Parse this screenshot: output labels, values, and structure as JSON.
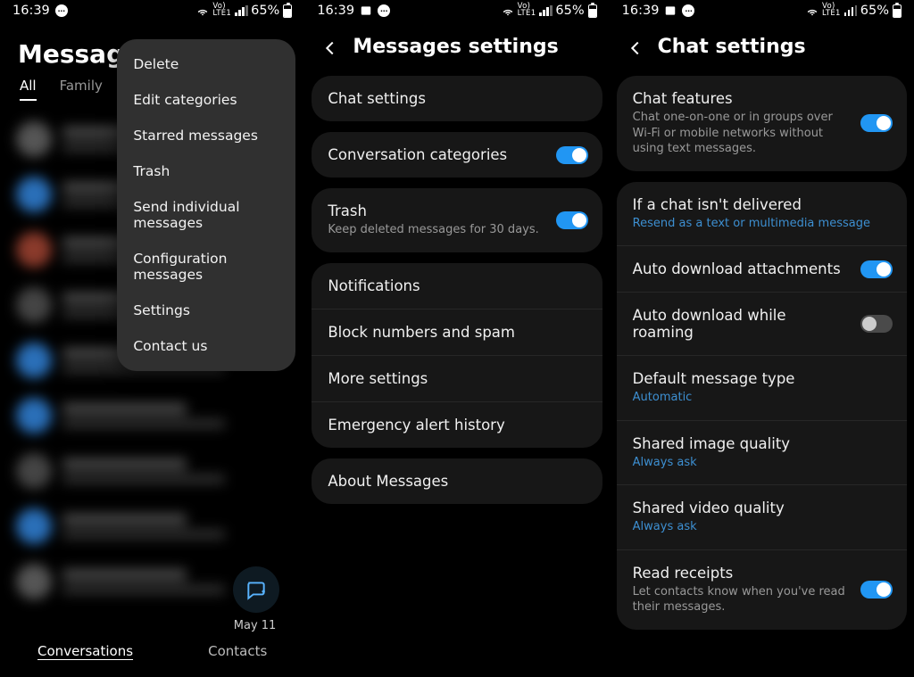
{
  "status": {
    "time": "16:39",
    "volte_top": "Vo)",
    "volte_bot": "LTE1",
    "battery": "65%"
  },
  "p1": {
    "title": "Messages",
    "tabs": [
      "All",
      "Family"
    ],
    "menu": [
      "Delete",
      "Edit categories",
      "Starred messages",
      "Trash",
      "Send individual messages",
      "Configuration messages",
      "Settings",
      "Contact us"
    ],
    "fab_date": "May 11",
    "bottom_nav": [
      "Conversations",
      "Contacts"
    ]
  },
  "p2": {
    "title": "Messages settings",
    "groups": [
      [
        {
          "title": "Chat settings"
        }
      ],
      [
        {
          "title": "Conversation categories",
          "toggle": true
        }
      ],
      [
        {
          "title": "Trash",
          "sub": "Keep deleted messages for 30 days.",
          "toggle": true
        }
      ],
      [
        {
          "title": "Notifications"
        },
        {
          "title": "Block numbers and spam"
        },
        {
          "title": "More settings"
        },
        {
          "title": "Emergency alert history"
        }
      ],
      [
        {
          "title": "About Messages"
        }
      ]
    ]
  },
  "p3": {
    "title": "Chat settings",
    "groups": [
      [
        {
          "title": "Chat features",
          "sub": "Chat one-on-one or in groups over Wi-Fi or mobile networks without using text messages.",
          "toggle": true
        }
      ],
      [
        {
          "title": "If a chat isn't delivered",
          "sub": "Resend as a text or multimedia message",
          "blue": true
        },
        {
          "title": "Auto download attachments",
          "toggle": true
        },
        {
          "title": "Auto download while roaming",
          "toggle": false
        },
        {
          "title": "Default message type",
          "sub": "Automatic",
          "blue": true
        },
        {
          "title": "Shared image quality",
          "sub": "Always ask",
          "blue": true
        },
        {
          "title": "Shared video quality",
          "sub": "Always ask",
          "blue": true
        },
        {
          "title": "Read receipts",
          "sub": "Let contacts know when you've read their messages.",
          "toggle": true
        }
      ]
    ]
  }
}
